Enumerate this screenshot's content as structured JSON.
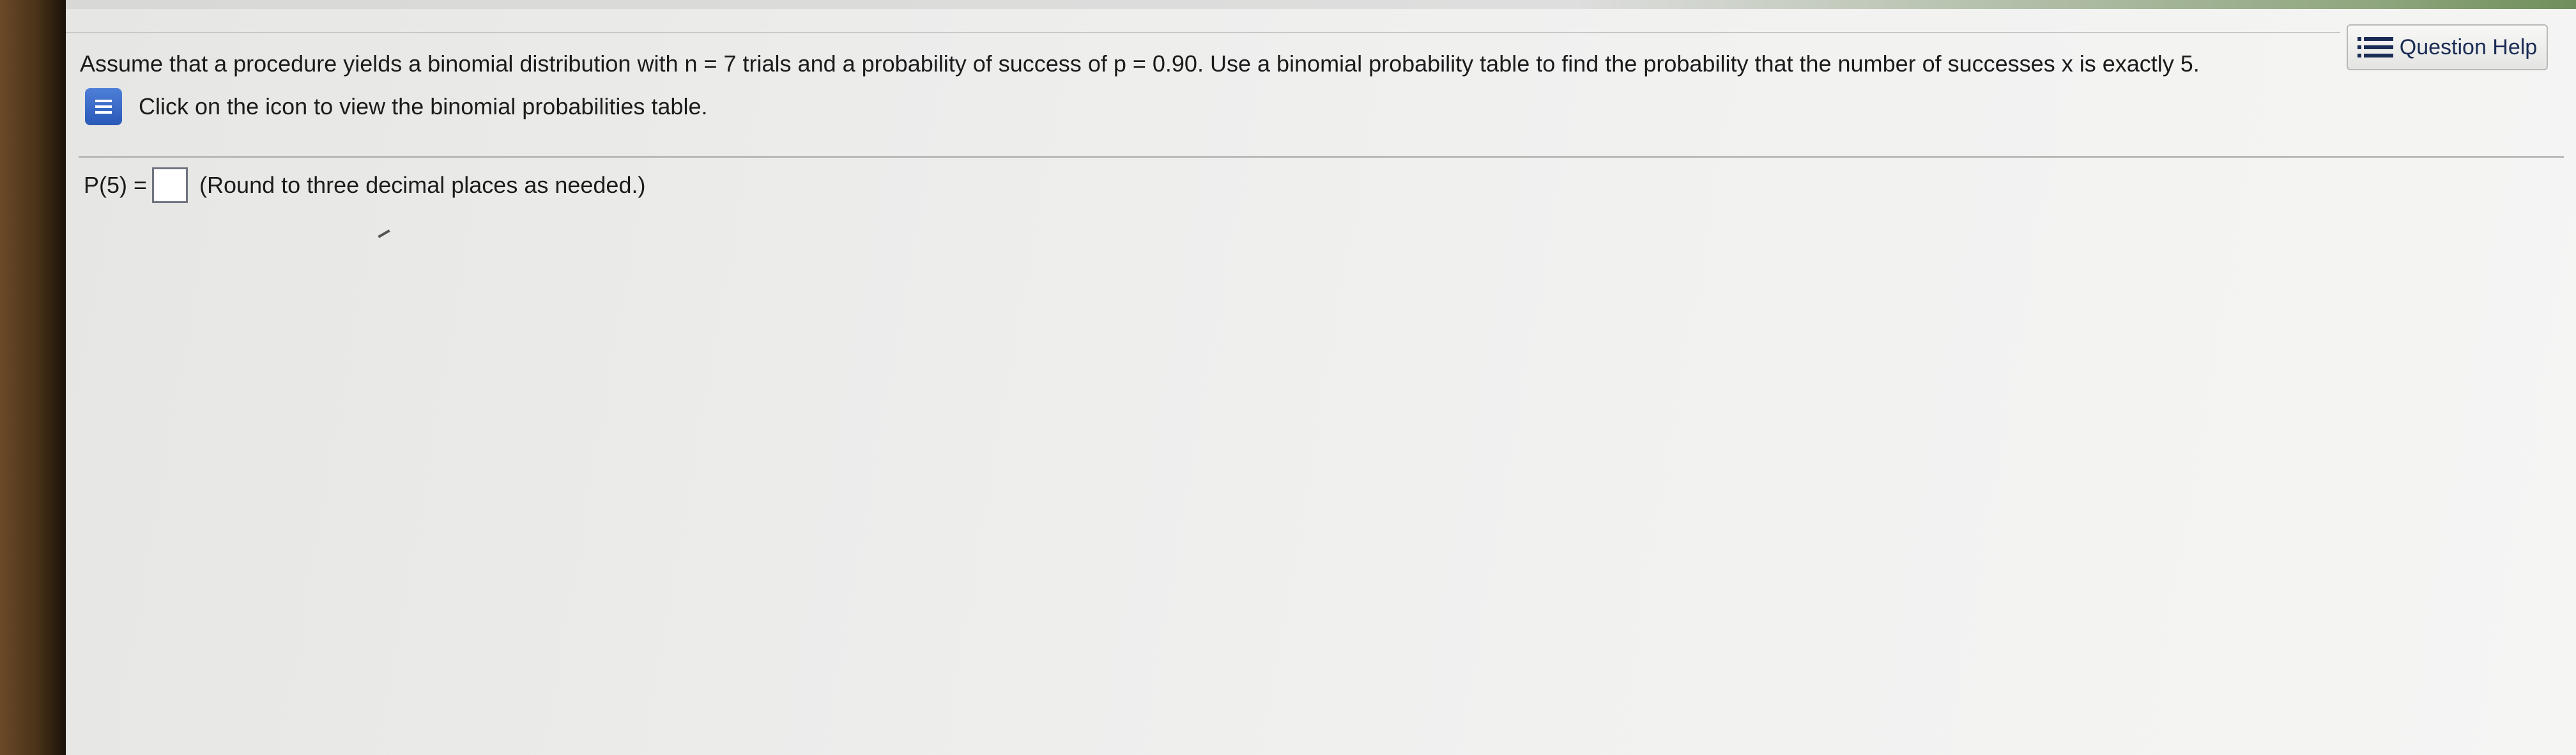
{
  "header": {
    "help_label": "Question Help",
    "help_icon": "list-icon"
  },
  "question": {
    "text": "Assume that a procedure yields a binomial distribution with n = 7 trials and a probability of success of p = 0.90. Use a binomial probability table to find the probability that the number of successes x is exactly 5.",
    "hint": "Click on the icon to view the binomial probabilities table.",
    "hint_icon": "table-icon"
  },
  "answer": {
    "label": "P(5) =",
    "value": "",
    "instruction": "(Round to three decimal places as needed.)"
  },
  "colors": {
    "accent_icon": "#2a59b8",
    "help_text": "#1a2c55",
    "background": "#ececeb"
  }
}
